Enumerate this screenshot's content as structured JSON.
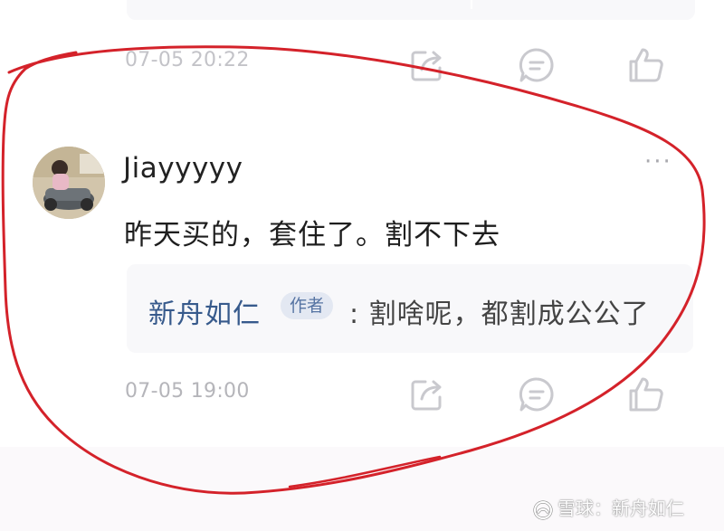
{
  "previous_comment": {
    "time": "07-05 20:22"
  },
  "comment": {
    "username": "Jiayyyyy",
    "more_label": "···",
    "text": "昨天买的，套住了。割不下去",
    "reply": {
      "author": "新舟如仁",
      "badge": "作者",
      "text": ": 割啥呢，都割成公公了"
    },
    "time": "07-05 19:00"
  },
  "actions": {
    "share_icon": "share-icon",
    "reply_icon": "comment-icon",
    "like_icon": "thumbs-up-icon"
  },
  "watermark": {
    "logo_text": "雪球",
    "text": "雪球：新舟如仁"
  },
  "colors": {
    "annotation_red": "#d4222a",
    "author_blue": "#375a8c",
    "icon_gray": "#c9c9ce"
  }
}
